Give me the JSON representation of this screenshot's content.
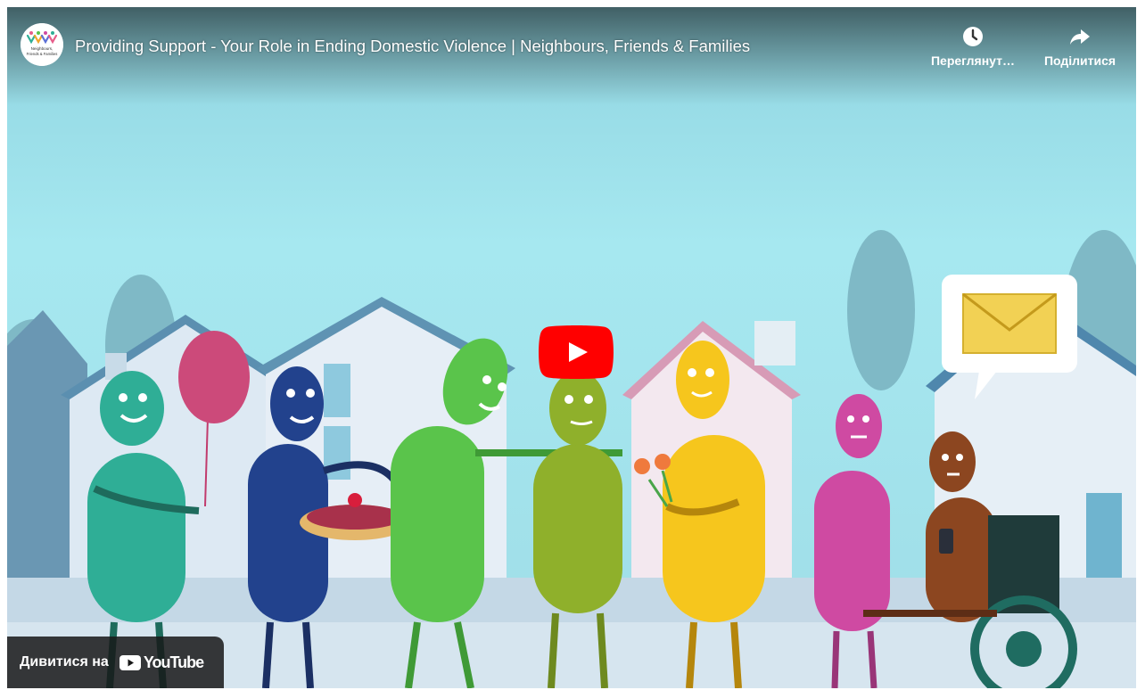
{
  "player": {
    "title": "Providing Support - Your Role in Ending Domestic Violence | Neighbours, Friends & Families",
    "channel": {
      "avatar_text_line1": "Neighbours,",
      "avatar_text_line2": "Friends & Families",
      "avatar_icon": "people-logo-icon"
    },
    "actions": {
      "watch_later_label": "Переглянути...",
      "watch_later_icon": "clock-icon",
      "share_label": "Поділитися",
      "share_icon": "share-arrow-icon"
    },
    "watch_on": {
      "label": "Дивитися на",
      "brand": "YouTube",
      "brand_icon": "youtube-logo-icon"
    },
    "play_icon": "play-icon"
  },
  "colors": {
    "play_red": "#ff0000",
    "sky": "#a9e4ef",
    "overlay_dark": "#171717"
  }
}
